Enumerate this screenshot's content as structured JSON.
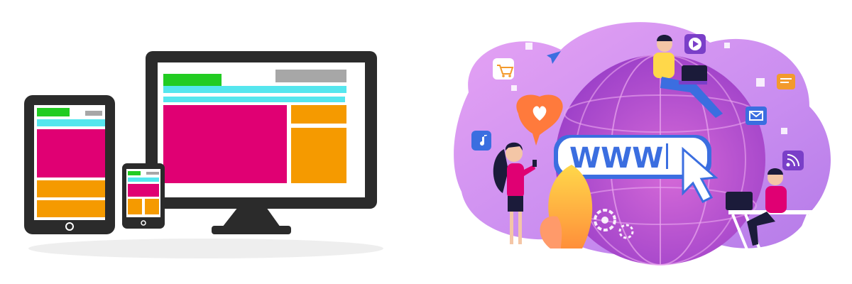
{
  "colors": {
    "frame": "#2b2b2b",
    "green": "#22cc22",
    "cyan": "#55e6ee",
    "gray": "#a7a7a7",
    "magenta": "#e00073",
    "orange": "#f59a00",
    "purple_bg": "#c98df0",
    "globe": "#b64fd6",
    "globe_light": "#d66ad8",
    "bar": "#3b6ee0"
  },
  "icons": [
    "cart-icon",
    "paper-plane-icon",
    "heart-icon",
    "music-note-icon",
    "video-play-icon",
    "chat-icon",
    "mail-icon",
    "rss-icon",
    "gear-icon",
    "cursor-icon"
  ],
  "globe_label": "WWW"
}
